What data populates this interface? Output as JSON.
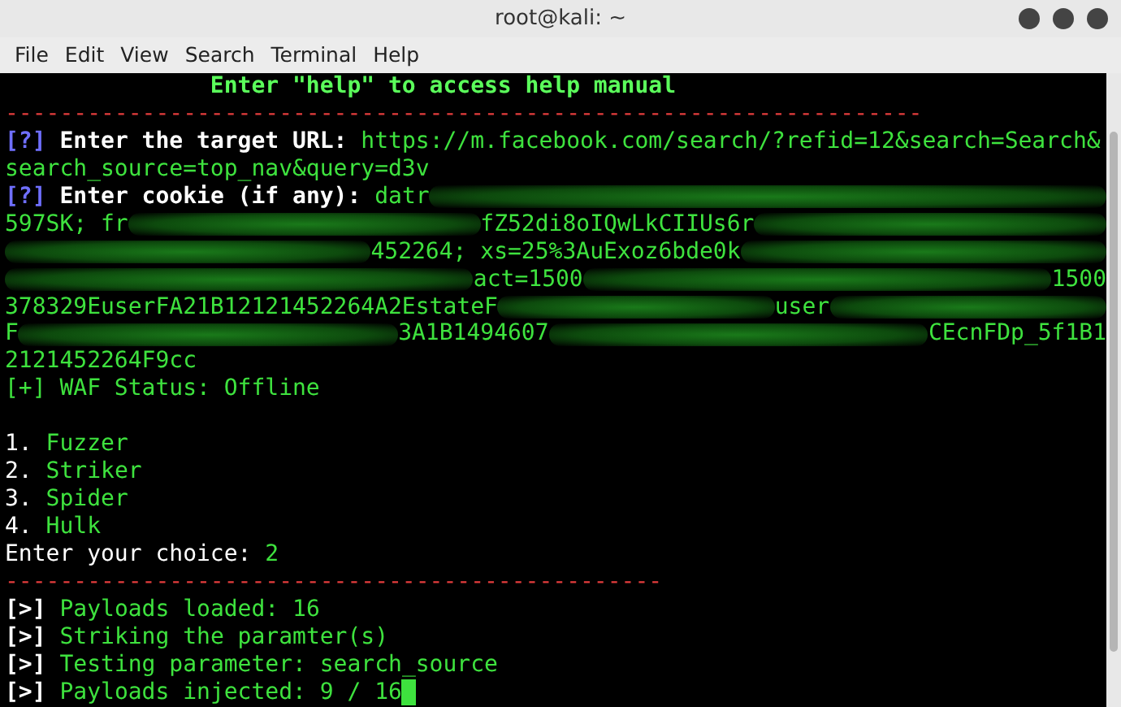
{
  "window": {
    "title": "root@kali: ~"
  },
  "menu": [
    "File",
    "Edit",
    "View",
    "Search",
    "Terminal",
    "Help"
  ],
  "terminal": {
    "lines": [
      [
        {
          "kind": "banner",
          "text": "               Enter \"help\" to access help manual"
        }
      ],
      [
        {
          "kind": "rule",
          "text": "-------------------------------------------------------------------"
        }
      ],
      [
        {
          "kind": "tag-query",
          "text": "[?]"
        },
        {
          "kind": "label",
          "text": " Enter the target URL: "
        },
        {
          "kind": "value",
          "text": "https://m.facebook.com/search/?refid=12&search=Search&"
        }
      ],
      [
        {
          "kind": "value",
          "text": "search_source=top_nav&query=d3v"
        }
      ],
      [
        {
          "kind": "tag-query",
          "text": "[?]"
        },
        {
          "kind": "label",
          "text": " Enter cookie (if any): "
        },
        {
          "kind": "value",
          "text": "datr"
        },
        {
          "kind": "scribble"
        }
      ],
      [
        {
          "kind": "value",
          "text": "597SK; fr"
        },
        {
          "kind": "scribble"
        },
        {
          "kind": "value",
          "text": "fZ52di8oIQwLkCIIUs6r"
        },
        {
          "kind": "scribble"
        }
      ],
      [
        {
          "kind": "scribble"
        },
        {
          "kind": "value",
          "text": "452264; xs=25%3AuExoz6bde0k"
        },
        {
          "kind": "scribble"
        }
      ],
      [
        {
          "kind": "scribble"
        },
        {
          "kind": "value",
          "text": "act=1500"
        },
        {
          "kind": "scribble"
        },
        {
          "kind": "value",
          "text": "1500"
        }
      ],
      [
        {
          "kind": "value",
          "text": "378329EuserFA21B12121452264A2EstateF"
        },
        {
          "kind": "scribble"
        },
        {
          "kind": "value",
          "text": "user"
        },
        {
          "kind": "scribble"
        }
      ],
      [
        {
          "kind": "value",
          "text": "F"
        },
        {
          "kind": "scribble"
        },
        {
          "kind": "value",
          "text": "3A1B1494607"
        },
        {
          "kind": "scribble"
        },
        {
          "kind": "value",
          "text": "CEcnFDp_5f1B1"
        }
      ],
      [
        {
          "kind": "value",
          "text": "2121452264F9cc"
        }
      ],
      [
        {
          "kind": "value",
          "text": "[+] WAF Status: Offline"
        }
      ],
      [
        {
          "kind": "blank"
        }
      ],
      [
        {
          "kind": "plain",
          "text": "1. "
        },
        {
          "kind": "value",
          "text": "Fuzzer"
        }
      ],
      [
        {
          "kind": "plain",
          "text": "2. "
        },
        {
          "kind": "value",
          "text": "Striker"
        }
      ],
      [
        {
          "kind": "plain",
          "text": "3. "
        },
        {
          "kind": "value",
          "text": "Spider"
        }
      ],
      [
        {
          "kind": "plain",
          "text": "4. "
        },
        {
          "kind": "value",
          "text": "Hulk"
        }
      ],
      [
        {
          "kind": "plain",
          "text": "Enter your choice: "
        },
        {
          "kind": "value",
          "text": "2"
        }
      ],
      [
        {
          "kind": "rule",
          "text": "------------------------------------------------"
        }
      ],
      [
        {
          "kind": "tag-run",
          "text": "[>]"
        },
        {
          "kind": "value",
          "text": " Payloads loaded: 16"
        }
      ],
      [
        {
          "kind": "tag-run",
          "text": "[>]"
        },
        {
          "kind": "value",
          "text": " Striking the paramter(s)"
        }
      ],
      [
        {
          "kind": "tag-run",
          "text": "[>]"
        },
        {
          "kind": "value",
          "text": " Testing parameter: search_source"
        }
      ],
      [
        {
          "kind": "tag-run",
          "text": "[>]"
        },
        {
          "kind": "value",
          "text": " Payloads injected: 9 / 16"
        },
        {
          "kind": "cursor"
        }
      ]
    ]
  }
}
